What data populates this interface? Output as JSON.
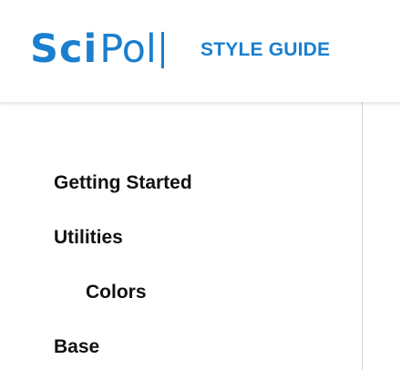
{
  "header": {
    "logo": {
      "sci": "Sci",
      "pol": "Pol"
    },
    "section_title": "STYLE GUIDE"
  },
  "sidebar": {
    "items": [
      {
        "label": "Getting Started",
        "level": 1
      },
      {
        "label": "Utilities",
        "level": 1
      },
      {
        "label": "Colors",
        "level": 2
      },
      {
        "label": "Base",
        "level": 1
      }
    ]
  },
  "colors": {
    "brand": "#1a7fcf",
    "nav_text": "#111111",
    "divider": "#d6d6d6",
    "background": "#ffffff"
  }
}
